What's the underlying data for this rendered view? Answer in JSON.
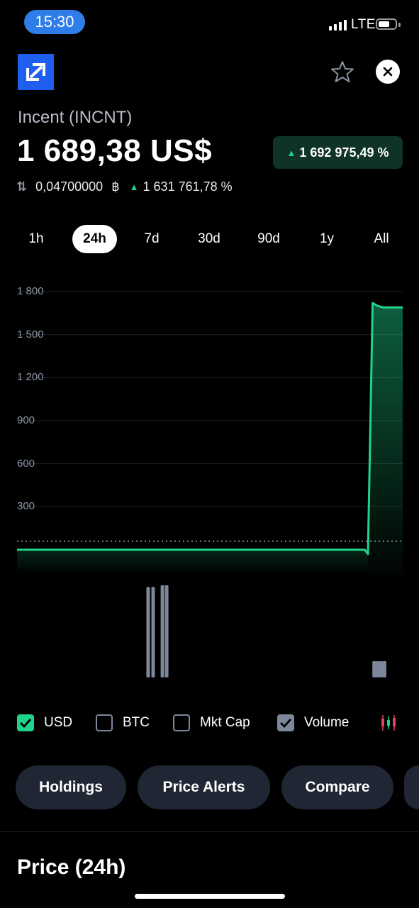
{
  "status_bar": {
    "time": "15:30",
    "network": "LTE"
  },
  "coin": {
    "name": "Incent (INCNT)",
    "price": "1 689,38 US$",
    "change_pct": "1 692 975,49 %",
    "btc_price": "0,04700000",
    "btc_symbol": "฿",
    "btc_change_pct": "1 631 761,78 %"
  },
  "icons": {
    "logo": "bancor-style-logo",
    "favorite": "star-icon",
    "close": "close-icon",
    "swap": "swap-arrows-icon",
    "candles": "candlestick-icon"
  },
  "tabs": [
    {
      "label": "1h"
    },
    {
      "label": "24h",
      "active": true
    },
    {
      "label": "7d"
    },
    {
      "label": "30d"
    },
    {
      "label": "90d"
    },
    {
      "label": "1y"
    },
    {
      "label": "All"
    }
  ],
  "colors": {
    "accent_green": "#1fd48a",
    "brand_blue": "#1f5ff0",
    "volume_bar": "#7e889c"
  },
  "chart_data": {
    "type": "line",
    "y_ticks": [
      "1 800",
      "1 500",
      "1 200",
      "900",
      "600",
      "300"
    ],
    "y_tick_values": [
      1800,
      1500,
      1200,
      900,
      600,
      300
    ],
    "ylim": [
      -20,
      1800
    ],
    "xlim": [
      0,
      100
    ],
    "grid": true,
    "series": [
      {
        "x": [
          0,
          25,
          50,
          75,
          89.5,
          90.2,
          91.0,
          92.2,
          93.5,
          95,
          100
        ],
        "values": [
          0.09,
          0.09,
          0.09,
          0.09,
          0.09,
          0.09,
          -30,
          1720,
          1700,
          1689,
          1689
        ]
      }
    ],
    "reference_value": 60,
    "volume": {
      "x": [
        34,
        35.3,
        37.7,
        38.8,
        92.6,
        93.5,
        94.4,
        95.3
      ],
      "values": [
        100,
        100,
        102,
        102,
        18,
        18,
        18,
        18
      ]
    }
  },
  "legend": [
    {
      "label": "USD",
      "checked": true
    },
    {
      "label": "BTC",
      "checked": false
    },
    {
      "label": "Mkt Cap",
      "checked": false
    },
    {
      "label": "Volume",
      "checked": true
    }
  ],
  "actions": [
    {
      "label": "Holdings"
    },
    {
      "label": "Price Alerts"
    },
    {
      "label": "Compare"
    }
  ],
  "section": {
    "title": "Price (24h)"
  }
}
